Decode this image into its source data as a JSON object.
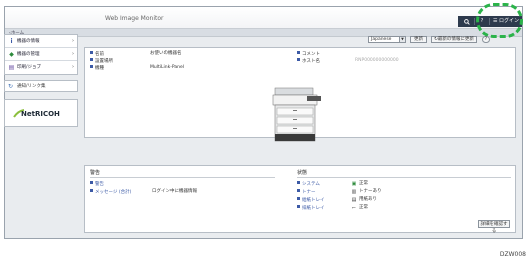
{
  "app": {
    "title": "Web Image Monitor"
  },
  "topbar": {
    "search_icon": "search-icon",
    "help_label": "?",
    "login_label": "ログイン",
    "menu_icon": "menu-icon"
  },
  "subbar": {
    "home_label": "ホーム"
  },
  "sidebar": {
    "items": [
      {
        "label": "機器の情報",
        "icon": "info-icon"
      },
      {
        "label": "機器の管理",
        "icon": "gear-icon"
      },
      {
        "label": "印刷/ジョブ",
        "icon": "document-icon"
      }
    ],
    "link_label": "通知/リンク集",
    "logo_text": "NetRICOH"
  },
  "controls": {
    "language": "Japanese",
    "refresh_label": "更新",
    "latest_label": "最新の情報に更新",
    "help_label": "?"
  },
  "device_info": {
    "left": [
      {
        "label": "名前",
        "value": "お使いの機器名"
      },
      {
        "label": "設置場所",
        "value": ""
      },
      {
        "label": "機種",
        "value": "MultiLink-Panel"
      }
    ],
    "right": [
      {
        "label": "コメント",
        "value": ""
      },
      {
        "label": "ホスト名",
        "value": "RNP000000000000"
      }
    ]
  },
  "alerts": {
    "title": "警告",
    "rows": [
      {
        "label": "警告",
        "value": ""
      },
      {
        "label": "メッセージ (合計)",
        "value": "ログイン中に機器情報"
      }
    ]
  },
  "status": {
    "title": "状態",
    "rows": [
      {
        "label": "システム",
        "value": "正常",
        "icon": "check-icon"
      },
      {
        "label": "トナー",
        "value": "トナーあり",
        "icon": "toner-icon"
      },
      {
        "label": "給紙トレイ",
        "value": "用紙あり",
        "icon": "tray-icon"
      },
      {
        "label": "排紙トレイ",
        "value": "正常",
        "icon": "output-tray-icon"
      }
    ],
    "detail_button": "詳細を確認する"
  },
  "footer_code": "DZW008",
  "colors": {
    "topbar_dark": "#2d3a4d",
    "highlight": "#2bb34a",
    "accent_blue": "#3c5aa6"
  }
}
